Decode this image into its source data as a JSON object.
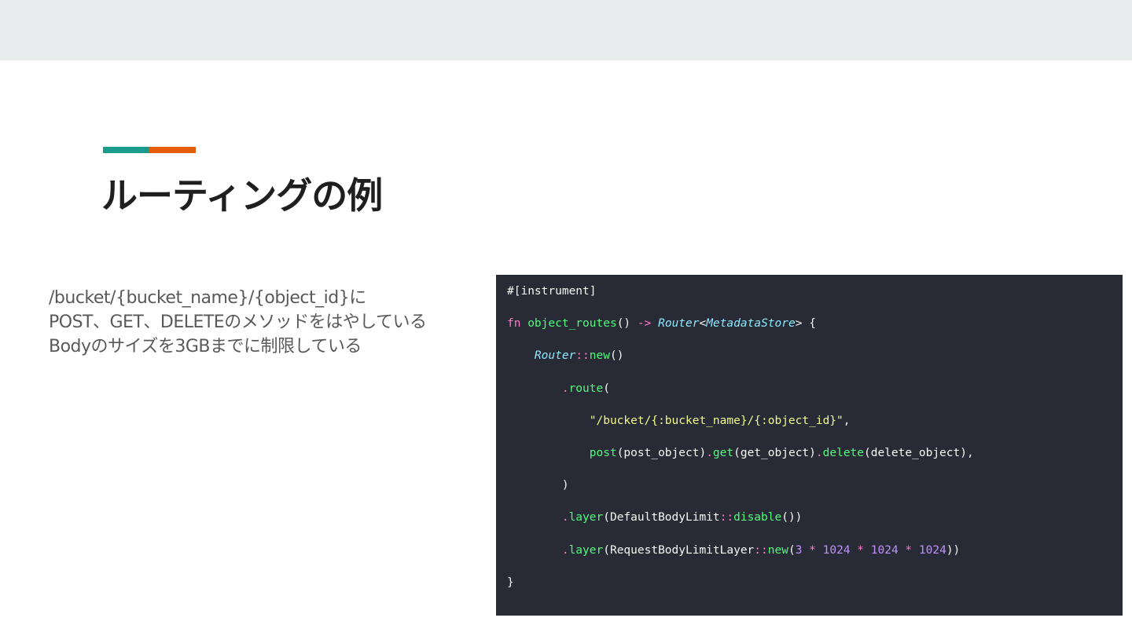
{
  "slide": {
    "title": "ルーティングの例",
    "colors": {
      "band": "#e8ecec",
      "accent_teal": "#1a9c8c",
      "accent_orange": "#e35d0b",
      "code_bg": "#282a36"
    },
    "body_lines": [
      "/bucket/{bucket_name}/{object_id}に",
      "POST、GET、DELETEのメソッドをはやしている",
      "Bodyのサイズを3GBまでに制限している"
    ]
  },
  "code": {
    "syntax_colors": {
      "plain": "#f8f8f2",
      "keyword": "#ff79c6",
      "function": "#50fa7b",
      "type": "#8be9fd",
      "string": "#f1fa8c",
      "number": "#bd93f9"
    },
    "lines": [
      [
        {
          "t": "#[instrument]",
          "c": "plain"
        }
      ],
      [
        {
          "t": "fn",
          "c": "keyword"
        },
        {
          "t": " ",
          "c": "plain"
        },
        {
          "t": "object_routes",
          "c": "function"
        },
        {
          "t": "() ",
          "c": "plain"
        },
        {
          "t": "->",
          "c": "keyword"
        },
        {
          "t": " ",
          "c": "plain"
        },
        {
          "t": "Router",
          "c": "type",
          "i": true
        },
        {
          "t": "<",
          "c": "plain"
        },
        {
          "t": "MetadataStore",
          "c": "type",
          "i": true
        },
        {
          "t": "> {",
          "c": "plain"
        }
      ],
      [
        {
          "t": "    ",
          "c": "plain"
        },
        {
          "t": "Router",
          "c": "type",
          "i": true
        },
        {
          "t": "::",
          "c": "keyword"
        },
        {
          "t": "new",
          "c": "function"
        },
        {
          "t": "()",
          "c": "plain"
        }
      ],
      [
        {
          "t": "        ",
          "c": "plain"
        },
        {
          "t": ".",
          "c": "keyword"
        },
        {
          "t": "route",
          "c": "function"
        },
        {
          "t": "(",
          "c": "plain"
        }
      ],
      [
        {
          "t": "            ",
          "c": "plain"
        },
        {
          "t": "\"/bucket/{:bucket_name}/{:object_id}\"",
          "c": "string"
        },
        {
          "t": ",",
          "c": "plain"
        }
      ],
      [
        {
          "t": "            ",
          "c": "plain"
        },
        {
          "t": "post",
          "c": "function"
        },
        {
          "t": "(post_object)",
          "c": "plain"
        },
        {
          "t": ".",
          "c": "keyword"
        },
        {
          "t": "get",
          "c": "function"
        },
        {
          "t": "(get_object)",
          "c": "plain"
        },
        {
          "t": ".",
          "c": "keyword"
        },
        {
          "t": "delete",
          "c": "function"
        },
        {
          "t": "(delete_object),",
          "c": "plain"
        }
      ],
      [
        {
          "t": "        )",
          "c": "plain"
        }
      ],
      [
        {
          "t": "        ",
          "c": "plain"
        },
        {
          "t": ".",
          "c": "keyword"
        },
        {
          "t": "layer",
          "c": "function"
        },
        {
          "t": "(DefaultBodyLimit",
          "c": "plain"
        },
        {
          "t": "::",
          "c": "keyword"
        },
        {
          "t": "disable",
          "c": "function"
        },
        {
          "t": "())",
          "c": "plain"
        }
      ],
      [
        {
          "t": "        ",
          "c": "plain"
        },
        {
          "t": ".",
          "c": "keyword"
        },
        {
          "t": "layer",
          "c": "function"
        },
        {
          "t": "(RequestBodyLimitLayer",
          "c": "plain"
        },
        {
          "t": "::",
          "c": "keyword"
        },
        {
          "t": "new",
          "c": "function"
        },
        {
          "t": "(",
          "c": "plain"
        },
        {
          "t": "3",
          "c": "number"
        },
        {
          "t": " ",
          "c": "plain"
        },
        {
          "t": "*",
          "c": "keyword"
        },
        {
          "t": " ",
          "c": "plain"
        },
        {
          "t": "1024",
          "c": "number"
        },
        {
          "t": " ",
          "c": "plain"
        },
        {
          "t": "*",
          "c": "keyword"
        },
        {
          "t": " ",
          "c": "plain"
        },
        {
          "t": "1024",
          "c": "number"
        },
        {
          "t": " ",
          "c": "plain"
        },
        {
          "t": "*",
          "c": "keyword"
        },
        {
          "t": " ",
          "c": "plain"
        },
        {
          "t": "1024",
          "c": "number"
        },
        {
          "t": "))",
          "c": "plain"
        }
      ],
      [
        {
          "t": "}",
          "c": "plain"
        }
      ]
    ]
  }
}
